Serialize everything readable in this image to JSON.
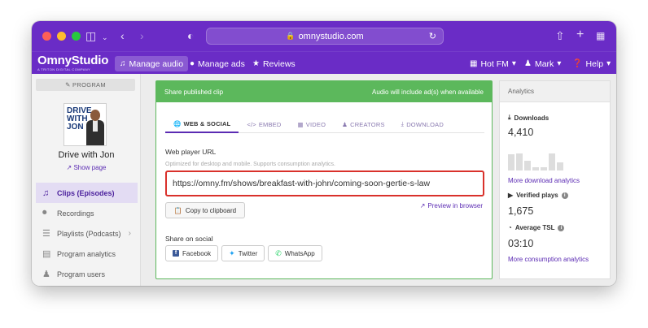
{
  "browser": {
    "url": "omnystudio.com",
    "traffic_lights": [
      "#ff5f57",
      "#febc2e",
      "#28c840"
    ]
  },
  "appnav": {
    "logo": "OmnyStudio",
    "logo_tagline": "A TRITON DIGITAL COMPANY",
    "items": [
      {
        "label": "Manage audio",
        "icon": "music-note-icon",
        "active": true
      },
      {
        "label": "Manage ads",
        "icon": "dollar-icon",
        "active": false
      },
      {
        "label": "Reviews",
        "icon": "star-icon",
        "active": false
      }
    ],
    "right": [
      {
        "label": "Hot FM",
        "icon": "building-icon"
      },
      {
        "label": "Mark",
        "icon": "user-icon"
      },
      {
        "label": "Help",
        "icon": "question-icon"
      }
    ]
  },
  "sidebar": {
    "section_label": "PROGRAM",
    "cover_text": [
      "DRIVE",
      "WITH",
      "JON"
    ],
    "program_name": "Drive with Jon",
    "show_page": "Show page",
    "items": [
      {
        "label": "Clips (Episodes)",
        "icon": "music-note-icon",
        "active": true
      },
      {
        "label": "Recordings",
        "icon": "microphone-icon",
        "active": false
      },
      {
        "label": "Playlists (Podcasts)",
        "icon": "list-icon",
        "active": false
      },
      {
        "label": "Program analytics",
        "icon": "bar-chart-icon",
        "active": false
      },
      {
        "label": "Program users",
        "icon": "user-icon",
        "active": false
      }
    ]
  },
  "main": {
    "header_left": "Share published clip",
    "header_right": "Audio will include ad(s) when available",
    "tabs": [
      {
        "label": "WEB & SOCIAL",
        "icon": "globe-icon",
        "active": true
      },
      {
        "label": "EMBED",
        "icon": "code-icon",
        "active": false
      },
      {
        "label": "VIDEO",
        "icon": "film-icon",
        "active": false
      },
      {
        "label": "CREATORS",
        "icon": "user-icon",
        "active": false
      },
      {
        "label": "DOWNLOAD",
        "icon": "download-icon",
        "active": false
      }
    ],
    "field_label": "Web player URL",
    "field_help": "Optimized for desktop and mobile. Supports consumption analytics.",
    "url_value": "https://omny.fm/shows/breakfast-with-john/coming-soon-gertie-s-law",
    "copy_button": "Copy to clipboard",
    "preview_link": "Preview in browser",
    "share_label": "Share on social",
    "share_buttons": [
      "Facebook",
      "Twitter",
      "WhatsApp"
    ]
  },
  "analytics": {
    "title": "Analytics",
    "downloads_label": "Downloads",
    "downloads_value": "4,410",
    "downloads_sparkline": [
      0.9,
      0.95,
      0.55,
      0.2,
      0.2,
      0.95,
      0.45
    ],
    "downloads_link": "More download analytics",
    "verified_label": "Verified plays",
    "verified_value": "1,675",
    "tsl_label": "Average TSL",
    "tsl_value": "03:10",
    "consumption_link": "More consumption analytics"
  }
}
